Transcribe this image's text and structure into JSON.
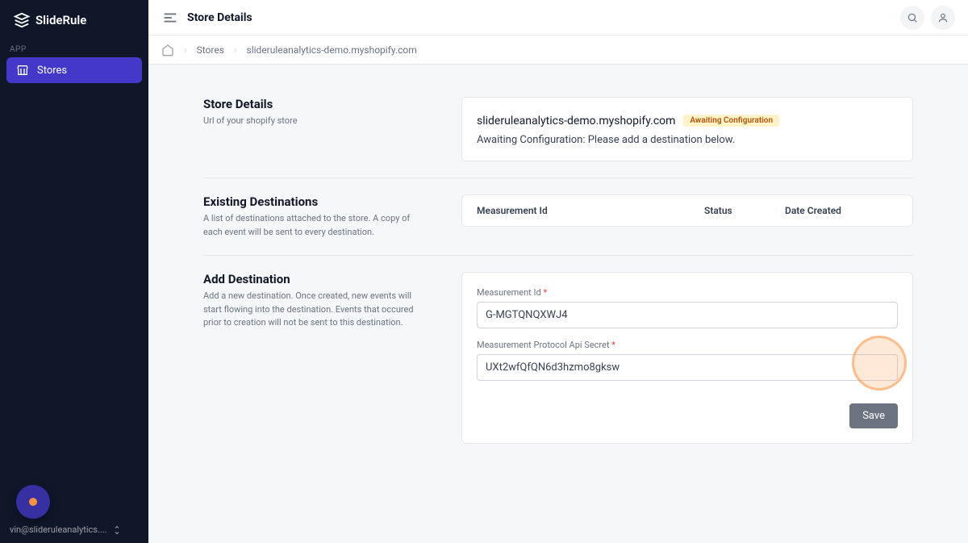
{
  "app": {
    "name": "SlideRule"
  },
  "sidebar": {
    "section_label": "APP",
    "items": [
      {
        "label": "Stores",
        "active": true
      }
    ],
    "footer_email": "vin@slideruleanalytics...."
  },
  "topbar": {
    "title": "Store Details"
  },
  "breadcrumb": {
    "items": [
      {
        "label": "Stores"
      },
      {
        "label": "slideruleanalytics-demo.myshopify.com"
      }
    ]
  },
  "store_details": {
    "title": "Store Details",
    "desc": "Url of your shopify store",
    "url": "slideruleanalytics-demo.myshopify.com",
    "badge": "Awaiting Configuration",
    "status_text": "Awaiting Configuration: Please add a destination below."
  },
  "existing": {
    "title": "Existing Destinations",
    "desc": "A list of destinations attached to the store. A copy of each event will be sent to every destination.",
    "headers": {
      "mid": "Measurement Id",
      "status": "Status",
      "date": "Date Created"
    }
  },
  "add_dest": {
    "title": "Add Destination",
    "desc": "Add a new destination. Once created, new events will start flowing into the destination. Events that occured prior to creation will not be sent to this destination.",
    "mid_label": "Measurement Id",
    "mid_value": "G-MGTQNQXWJ4",
    "secret_label": "Measurement Protocol Api Secret",
    "secret_value": "UXt2wfQfQN6d3hzmo8gksw",
    "save_label": "Save"
  }
}
